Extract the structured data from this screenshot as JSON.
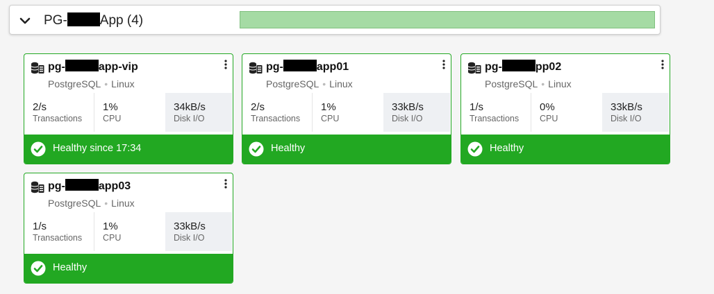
{
  "group": {
    "prefix": "PG-",
    "suffix": "App (4)",
    "bar_color": "#a5dba4",
    "expand_icon": "chevron-down-icon"
  },
  "status_color": "#22a822",
  "cards": [
    {
      "name_prefix": "pg-",
      "name_suffix": "app-vip",
      "db": "PostgreSQL",
      "os": "Linux",
      "metrics": [
        {
          "value": "2/s",
          "label": "Transactions"
        },
        {
          "value": "1%",
          "label": "CPU"
        },
        {
          "value": "34kB/s",
          "label": "Disk I/O"
        }
      ],
      "status": "Healthy since 17:34"
    },
    {
      "name_prefix": "pg-",
      "name_suffix": "app01",
      "db": "PostgreSQL",
      "os": "Linux",
      "metrics": [
        {
          "value": "2/s",
          "label": "Transactions"
        },
        {
          "value": "1%",
          "label": "CPU"
        },
        {
          "value": "33kB/s",
          "label": "Disk I/O"
        }
      ],
      "status": "Healthy"
    },
    {
      "name_prefix": "pg-",
      "name_suffix": "pp02",
      "db": "PostgreSQL",
      "os": "Linux",
      "metrics": [
        {
          "value": "1/s",
          "label": "Transactions"
        },
        {
          "value": "0%",
          "label": "CPU"
        },
        {
          "value": "33kB/s",
          "label": "Disk I/O"
        }
      ],
      "status": "Healthy"
    },
    {
      "name_prefix": "pg-",
      "name_suffix": "app03",
      "db": "PostgreSQL",
      "os": "Linux",
      "metrics": [
        {
          "value": "1/s",
          "label": "Transactions"
        },
        {
          "value": "1%",
          "label": "CPU"
        },
        {
          "value": "33kB/s",
          "label": "Disk I/O"
        }
      ],
      "status": "Healthy"
    }
  ]
}
